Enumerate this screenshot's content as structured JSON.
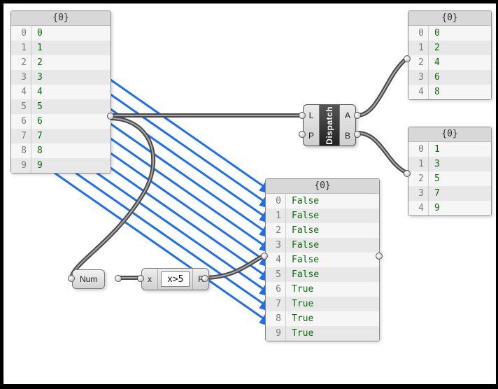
{
  "panels": {
    "input": {
      "header": "{0}",
      "items": [
        {
          "index": "0",
          "value": "0"
        },
        {
          "index": "1",
          "value": "1"
        },
        {
          "index": "2",
          "value": "2"
        },
        {
          "index": "3",
          "value": "3"
        },
        {
          "index": "4",
          "value": "4"
        },
        {
          "index": "5",
          "value": "5"
        },
        {
          "index": "6",
          "value": "6"
        },
        {
          "index": "7",
          "value": "7"
        },
        {
          "index": "8",
          "value": "8"
        },
        {
          "index": "9",
          "value": "9"
        }
      ]
    },
    "mask": {
      "header": "{0}",
      "items": [
        {
          "index": "0",
          "value": "False"
        },
        {
          "index": "1",
          "value": "False"
        },
        {
          "index": "2",
          "value": "False"
        },
        {
          "index": "3",
          "value": "False"
        },
        {
          "index": "4",
          "value": "False"
        },
        {
          "index": "5",
          "value": "False"
        },
        {
          "index": "6",
          "value": "True"
        },
        {
          "index": "7",
          "value": "True"
        },
        {
          "index": "8",
          "value": "True"
        },
        {
          "index": "9",
          "value": "True"
        }
      ]
    },
    "outA": {
      "header": "{0}",
      "items": [
        {
          "index": "0",
          "value": "0"
        },
        {
          "index": "1",
          "value": "2"
        },
        {
          "index": "2",
          "value": "4"
        },
        {
          "index": "3",
          "value": "6"
        },
        {
          "index": "4",
          "value": "8"
        }
      ]
    },
    "outB": {
      "header": "{0}",
      "items": [
        {
          "index": "0",
          "value": "1"
        },
        {
          "index": "1",
          "value": "3"
        },
        {
          "index": "2",
          "value": "5"
        },
        {
          "index": "3",
          "value": "7"
        },
        {
          "index": "4",
          "value": "9"
        }
      ]
    }
  },
  "components": {
    "num": {
      "label": "Num"
    },
    "expr": {
      "input": "x",
      "expression": "x>5",
      "output": "R"
    },
    "dispatch": {
      "label": "Dispatch",
      "inputs": [
        "L",
        "P"
      ],
      "outputs": [
        "A",
        "B"
      ]
    }
  },
  "colors": {
    "arrow": "#1e6ff0",
    "value_text": "#0a6b0a"
  }
}
